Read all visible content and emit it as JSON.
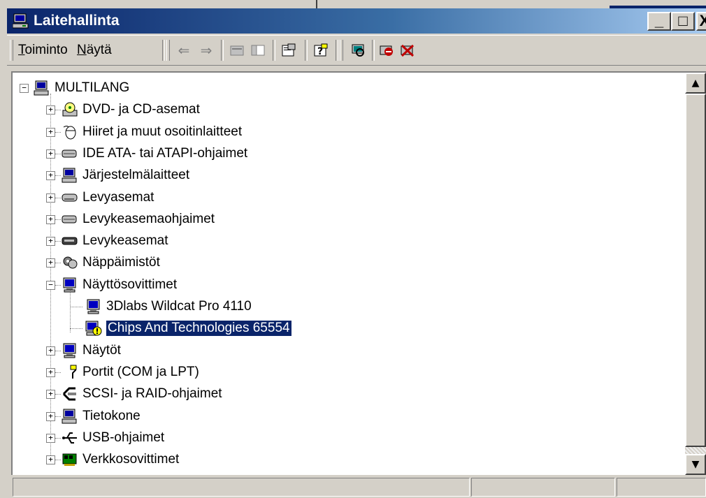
{
  "window": {
    "title": "Laitehallinta",
    "accent": "#0a246a"
  },
  "title_buttons": {
    "minimize": "_",
    "maximize": "□",
    "close": "X"
  },
  "menu": [
    {
      "label": "Toiminto",
      "accel": "T"
    },
    {
      "label": "Näytä",
      "accel": "N"
    }
  ],
  "toolbar_icons": [
    "back-arrow-icon",
    "forward-arrow-icon",
    "up-folder-icon",
    "show-hide-tree-icon",
    "properties-icon",
    "help-icon",
    "scan-hardware-icon",
    "disable-device-icon",
    "uninstall-device-icon"
  ],
  "toolbar_glyphs": {
    "back": "⇐",
    "forward": "⇒"
  },
  "tree": {
    "root": "MULTILANG",
    "categories": [
      {
        "label": "DVD- ja CD-asemat",
        "icon": "cdrom-icon",
        "expanded": false
      },
      {
        "label": "Hiiret ja muut osoitinlaitteet",
        "icon": "mouse-icon",
        "expanded": false
      },
      {
        "label": "IDE ATA- tai ATAPI-ohjaimet",
        "icon": "ide-controller-icon",
        "expanded": false
      },
      {
        "label": "Järjestelmälaitteet",
        "icon": "system-device-icon",
        "expanded": false
      },
      {
        "label": "Levyasemat",
        "icon": "disk-drive-icon",
        "expanded": false
      },
      {
        "label": "Levykeasemaohjaimet",
        "icon": "floppy-controller-icon",
        "expanded": false
      },
      {
        "label": "Levykeasemat",
        "icon": "floppy-drive-icon",
        "expanded": false
      },
      {
        "label": "Näppäimistöt",
        "icon": "keyboard-icon",
        "expanded": false
      },
      {
        "label": "Näyttösovittimet",
        "icon": "display-adapter-icon",
        "expanded": true,
        "children": [
          {
            "label": "3Dlabs Wildcat Pro 4110",
            "icon": "display-adapter-icon",
            "selected": false
          },
          {
            "label": "Chips And Technologies 65554",
            "icon": "warning-display-adapter-icon",
            "selected": true
          }
        ]
      },
      {
        "label": "Näytöt",
        "icon": "monitor-icon",
        "expanded": false
      },
      {
        "label": "Portit (COM ja LPT)",
        "icon": "port-icon",
        "expanded": false
      },
      {
        "label": "SCSI- ja RAID-ohjaimet",
        "icon": "scsi-icon",
        "expanded": false
      },
      {
        "label": "Tietokone",
        "icon": "computer-icon",
        "expanded": false
      },
      {
        "label": "USB-ohjaimet",
        "icon": "usb-icon",
        "expanded": false
      },
      {
        "label": "Verkkosovittimet",
        "icon": "network-adapter-icon",
        "expanded": false
      }
    ]
  },
  "scrollbar": {
    "up": "▲",
    "down": "▼"
  },
  "glyphs": {
    "collapsed": "+",
    "expanded": "−"
  }
}
